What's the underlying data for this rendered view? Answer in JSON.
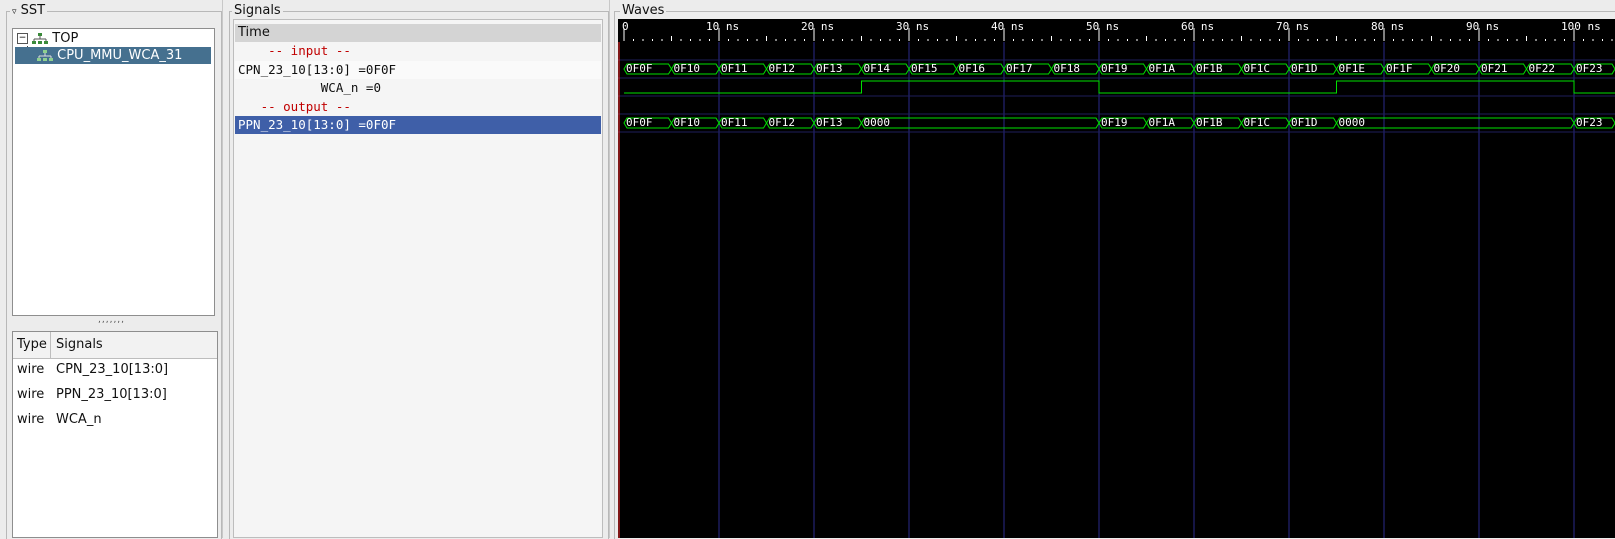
{
  "sst": {
    "title": "SST",
    "tree": [
      {
        "label": "TOP",
        "expander": "⊟"
      },
      {
        "label": "CPU_MMU_WCA_31"
      }
    ],
    "signal_list": {
      "col_type": "Type",
      "col_signals": "Signals",
      "items": [
        {
          "type": "wire",
          "name": "CPN_23_10[13:0]"
        },
        {
          "type": "wire",
          "name": "PPN_23_10[13:0]"
        },
        {
          "type": "wire",
          "name": "WCA_n"
        }
      ]
    }
  },
  "signals": {
    "title": "Signals",
    "header": "Time",
    "rows": [
      {
        "text": "    -- input --",
        "kind": "comment"
      },
      {
        "text": "CPN_23_10[13:0] =0F0F",
        "kind": "signal"
      },
      {
        "text": "           WCA_n =0",
        "kind": "signal"
      },
      {
        "text": "   -- output --",
        "kind": "comment"
      },
      {
        "text": "PPN_23_10[13:0] =0F0F",
        "kind": "selected"
      }
    ]
  },
  "waves": {
    "title": "Waves",
    "time_labels": [
      "0",
      "10 ns",
      "20 ns",
      "30 ns",
      "40 ns",
      "50 ns",
      "60 ns",
      "70 ns",
      "80 ns",
      "90 ns",
      "100 ns"
    ],
    "colors": {
      "background": "#000000",
      "wave": "#00e000",
      "grid": "#2a2a8a",
      "cursor": "#ff3030",
      "ruler_text": "#ffffff"
    },
    "bus_cpn": [
      "0F0F",
      "0F10",
      "0F11",
      "0F12",
      "0F13",
      "0F14",
      "0F15",
      "0F16",
      "0F17",
      "0F18",
      "0F19",
      "0F1A",
      "0F1B",
      "0F1C",
      "0F1D",
      "0F1E",
      "0F1F",
      "0F20",
      "0F21",
      "0F22",
      "0F23"
    ],
    "wca_n": [
      0,
      0,
      0,
      0,
      0,
      1,
      1,
      1,
      1,
      1,
      0,
      0,
      0,
      0,
      0,
      1,
      1,
      1,
      1,
      1,
      0
    ],
    "bus_ppn": [
      {
        "from": 0,
        "to": 1,
        "value": "0F0F"
      },
      {
        "from": 1,
        "to": 2,
        "value": "0F10"
      },
      {
        "from": 2,
        "to": 3,
        "value": "0F11"
      },
      {
        "from": 3,
        "to": 4,
        "value": "0F12"
      },
      {
        "from": 4,
        "to": 5,
        "value": "0F13"
      },
      {
        "from": 5,
        "to": 10,
        "value": "0000"
      },
      {
        "from": 10,
        "to": 11,
        "value": "0F19"
      },
      {
        "from": 11,
        "to": 12,
        "value": "0F1A"
      },
      {
        "from": 12,
        "to": 13,
        "value": "0F1B"
      },
      {
        "from": 13,
        "to": 14,
        "value": "0F1C"
      },
      {
        "from": 14,
        "to": 15,
        "value": "0F1D"
      },
      {
        "from": 15,
        "to": 20,
        "value": "0000"
      },
      {
        "from": 20,
        "to": 21,
        "value": "0F23"
      }
    ]
  }
}
